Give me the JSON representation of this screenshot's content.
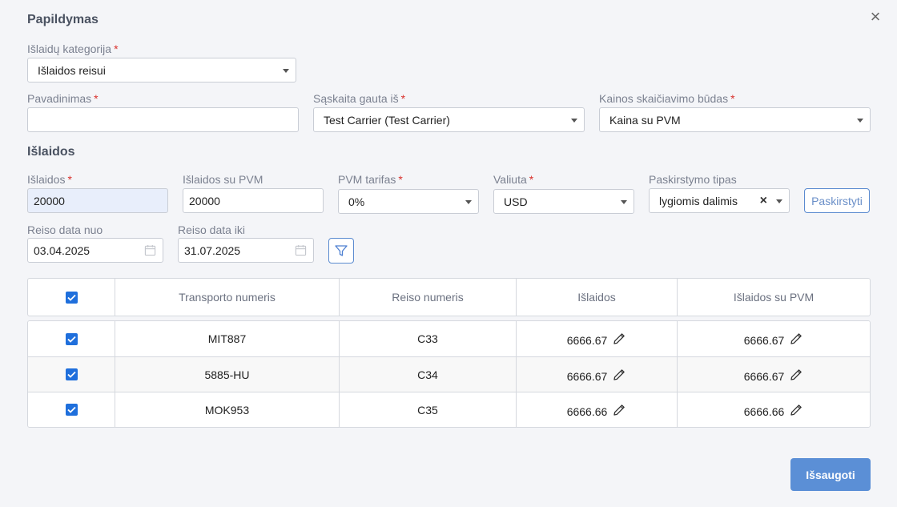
{
  "dialog": {
    "title": "Papildymas"
  },
  "form": {
    "category": {
      "label": "Išlaidų kategorija",
      "value": "Išlaidos reisui"
    },
    "name": {
      "label": "Pavadinimas",
      "value": ""
    },
    "invoice_from": {
      "label": "Sąskaita gauta iš",
      "value": "Test Carrier (Test Carrier)"
    },
    "price_method": {
      "label": "Kainos skaičiavimo būdas",
      "value": "Kaina su PVM"
    }
  },
  "section_title": "Išlaidos",
  "costs": {
    "amount": {
      "label": "Išlaidos",
      "value": "20000"
    },
    "amount_vat": {
      "label": "Išlaidos su PVM",
      "value": "20000"
    },
    "vat_rate": {
      "label": "PVM tarifas",
      "value": "0%"
    },
    "currency": {
      "label": "Valiuta",
      "value": "USD"
    },
    "distribution_type": {
      "label": "Paskirstymo tipas",
      "value": "lygiomis dalimis"
    },
    "distribute_button": "Paskirstyti"
  },
  "dates": {
    "from": {
      "label": "Reiso data nuo",
      "value": "03.04.2025"
    },
    "to": {
      "label": "Reiso data iki",
      "value": "31.07.2025"
    }
  },
  "table": {
    "headers": [
      "Transporto numeris",
      "Reiso numeris",
      "Išlaidos",
      "Išlaidos su PVM"
    ],
    "rows": [
      {
        "transport": "MIT887",
        "trip": "C33",
        "cost": "6666.67",
        "cost_vat": "6666.67"
      },
      {
        "transport": "5885-HU",
        "trip": "C34",
        "cost": "6666.67",
        "cost_vat": "6666.67"
      },
      {
        "transport": "MOK953",
        "trip": "C35",
        "cost": "6666.66",
        "cost_vat": "6666.66"
      }
    ]
  },
  "save_button": "Išsaugoti",
  "required_mark": "*",
  "icons": {
    "close": "close-icon",
    "caret": "chevron-down-icon",
    "calendar": "calendar-icon",
    "filter": "filter-icon",
    "edit": "pencil-icon",
    "check": "checkbox-checked-icon"
  },
  "colors": {
    "accent": "#1f6fdc",
    "save_bg": "#5b8fd6",
    "required": "#d9302c"
  }
}
